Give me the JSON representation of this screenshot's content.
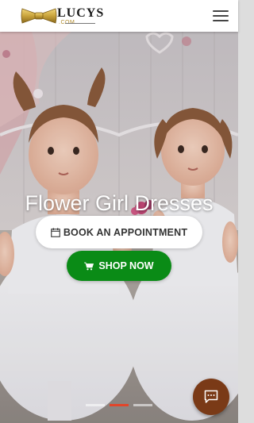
{
  "header": {
    "logo_text": "LUCYS",
    "logo_sub": ".COM",
    "menu_icon": "hamburger-menu-icon"
  },
  "hero": {
    "title": "Flower Girl Dresses",
    "appointment_button": "BOOK AN APPOINTMENT",
    "appointment_icon": "calendar-icon",
    "shop_button": "SHOP NOW",
    "shop_icon": "cart-icon",
    "slides": 3,
    "active_slide": 2
  },
  "chat": {
    "icon": "chat-bubble-icon"
  },
  "colors": {
    "shop_green": "#0a8b16",
    "chat_brown": "#7a3a17",
    "active_dot": "#e2452a"
  }
}
